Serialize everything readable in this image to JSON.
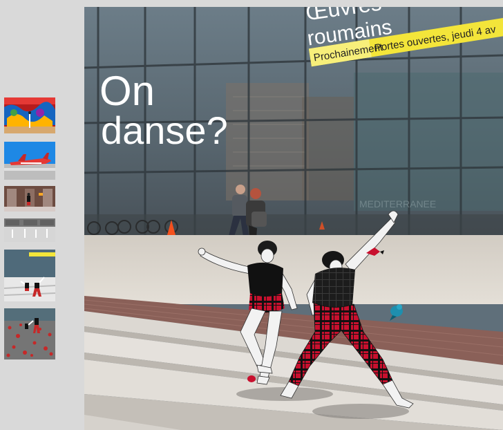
{
  "sidebar": {
    "thumbnails": [
      {
        "name": "thumb-graffiti-dancer",
        "selected": false
      },
      {
        "name": "thumb-red-aircraft",
        "selected": false
      },
      {
        "name": "thumb-dancer-arcade",
        "selected": false
      },
      {
        "name": "thumb-dancer-group",
        "selected": false
      },
      {
        "name": "thumb-current-dancers",
        "selected": true
      },
      {
        "name": "thumb-red-petals-dancers",
        "selected": false
      }
    ]
  },
  "viewer": {
    "sign_left": {
      "line1": "On",
      "line2": "danse?"
    },
    "sign_right": {
      "line1": "Œuvres",
      "line2": "roumains"
    },
    "banner": {
      "highlight": "Prochainement",
      "text": "Portes ouvertes, jeudi 4 av"
    },
    "glass_text": "MEDITERRANEE"
  },
  "colors": {
    "background": "#d9d9d9",
    "banner_yellow": "#f3e53a",
    "plaid_red": "#c8102e"
  }
}
